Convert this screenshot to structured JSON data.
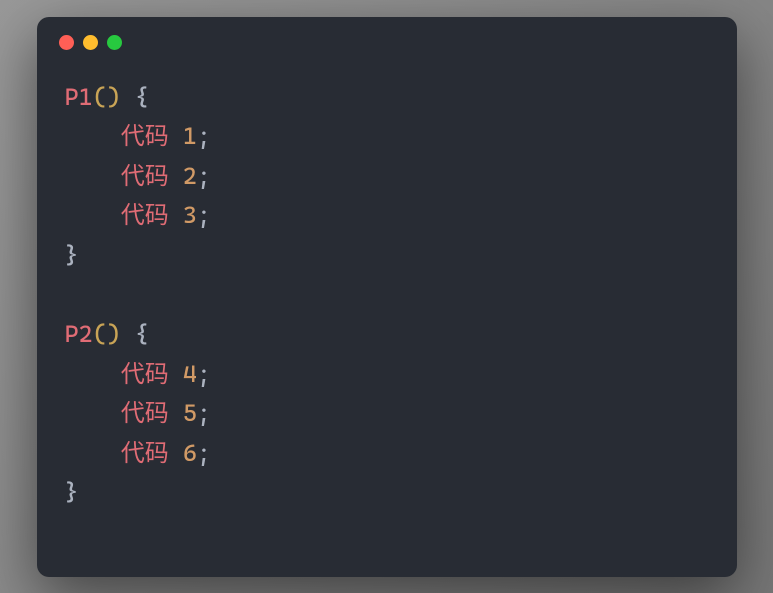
{
  "window": {
    "dots": [
      "red",
      "yellow",
      "green"
    ]
  },
  "code": {
    "fn1": {
      "name": "P1",
      "open_paren": "(",
      "close_paren": ")",
      "open_brace": "{",
      "close_brace": "}",
      "lines": [
        {
          "indent": "    ",
          "word": "代码",
          "space": " ",
          "num": "1",
          "semi": ";"
        },
        {
          "indent": "    ",
          "word": "代码",
          "space": " ",
          "num": "2",
          "semi": ";"
        },
        {
          "indent": "    ",
          "word": "代码",
          "space": " ",
          "num": "3",
          "semi": ";"
        }
      ]
    },
    "fn2": {
      "name": "P2",
      "open_paren": "(",
      "close_paren": ")",
      "open_brace": "{",
      "close_brace": "}",
      "lines": [
        {
          "indent": "    ",
          "word": "代码",
          "space": " ",
          "num": "4",
          "semi": ";"
        },
        {
          "indent": "    ",
          "word": "代码",
          "space": " ",
          "num": "5",
          "semi": ";"
        },
        {
          "indent": "    ",
          "word": "代码",
          "space": " ",
          "num": "6",
          "semi": ";"
        }
      ]
    }
  }
}
